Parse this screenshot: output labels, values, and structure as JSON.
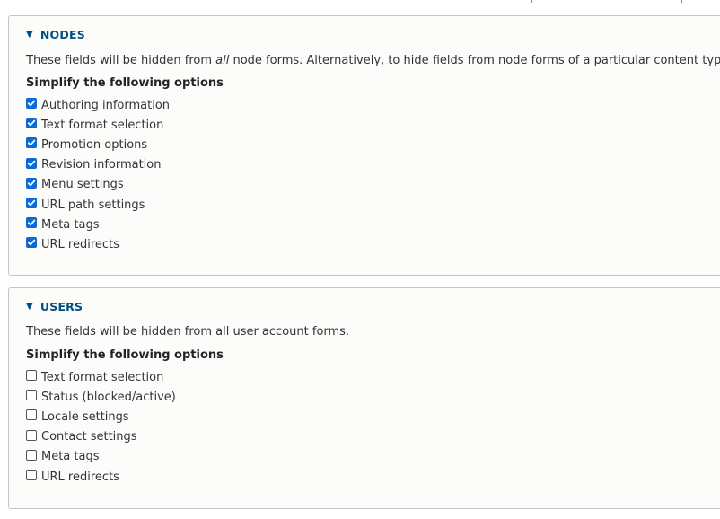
{
  "nodes": {
    "legend": "NODES",
    "description_pre": "These fields will be hidden from ",
    "description_em": "all",
    "description_post": " node forms. Alternatively, to hide fields from node forms of a particular content typ",
    "group_title": "Simplify the following options",
    "options": [
      {
        "label": "Authoring information",
        "checked": true
      },
      {
        "label": "Text format selection",
        "checked": true
      },
      {
        "label": "Promotion options",
        "checked": true
      },
      {
        "label": "Revision information",
        "checked": true
      },
      {
        "label": "Menu settings",
        "checked": true
      },
      {
        "label": "URL path settings",
        "checked": true
      },
      {
        "label": "Meta tags",
        "checked": true
      },
      {
        "label": "URL redirects",
        "checked": true
      }
    ]
  },
  "users": {
    "legend": "USERS",
    "description": "These fields will be hidden from all user account forms.",
    "group_title": "Simplify the following options",
    "options": [
      {
        "label": "Text format selection",
        "checked": false
      },
      {
        "label": "Status (blocked/active)",
        "checked": false
      },
      {
        "label": "Locale settings",
        "checked": false
      },
      {
        "label": "Contact settings",
        "checked": false
      },
      {
        "label": "Meta tags",
        "checked": false
      },
      {
        "label": "URL redirects",
        "checked": false
      }
    ]
  },
  "colors": {
    "legend": "#004f80",
    "checkbox_checked": "#0b6ad8",
    "panel_bg": "#fcfcfa",
    "border": "#c4c4c4"
  }
}
